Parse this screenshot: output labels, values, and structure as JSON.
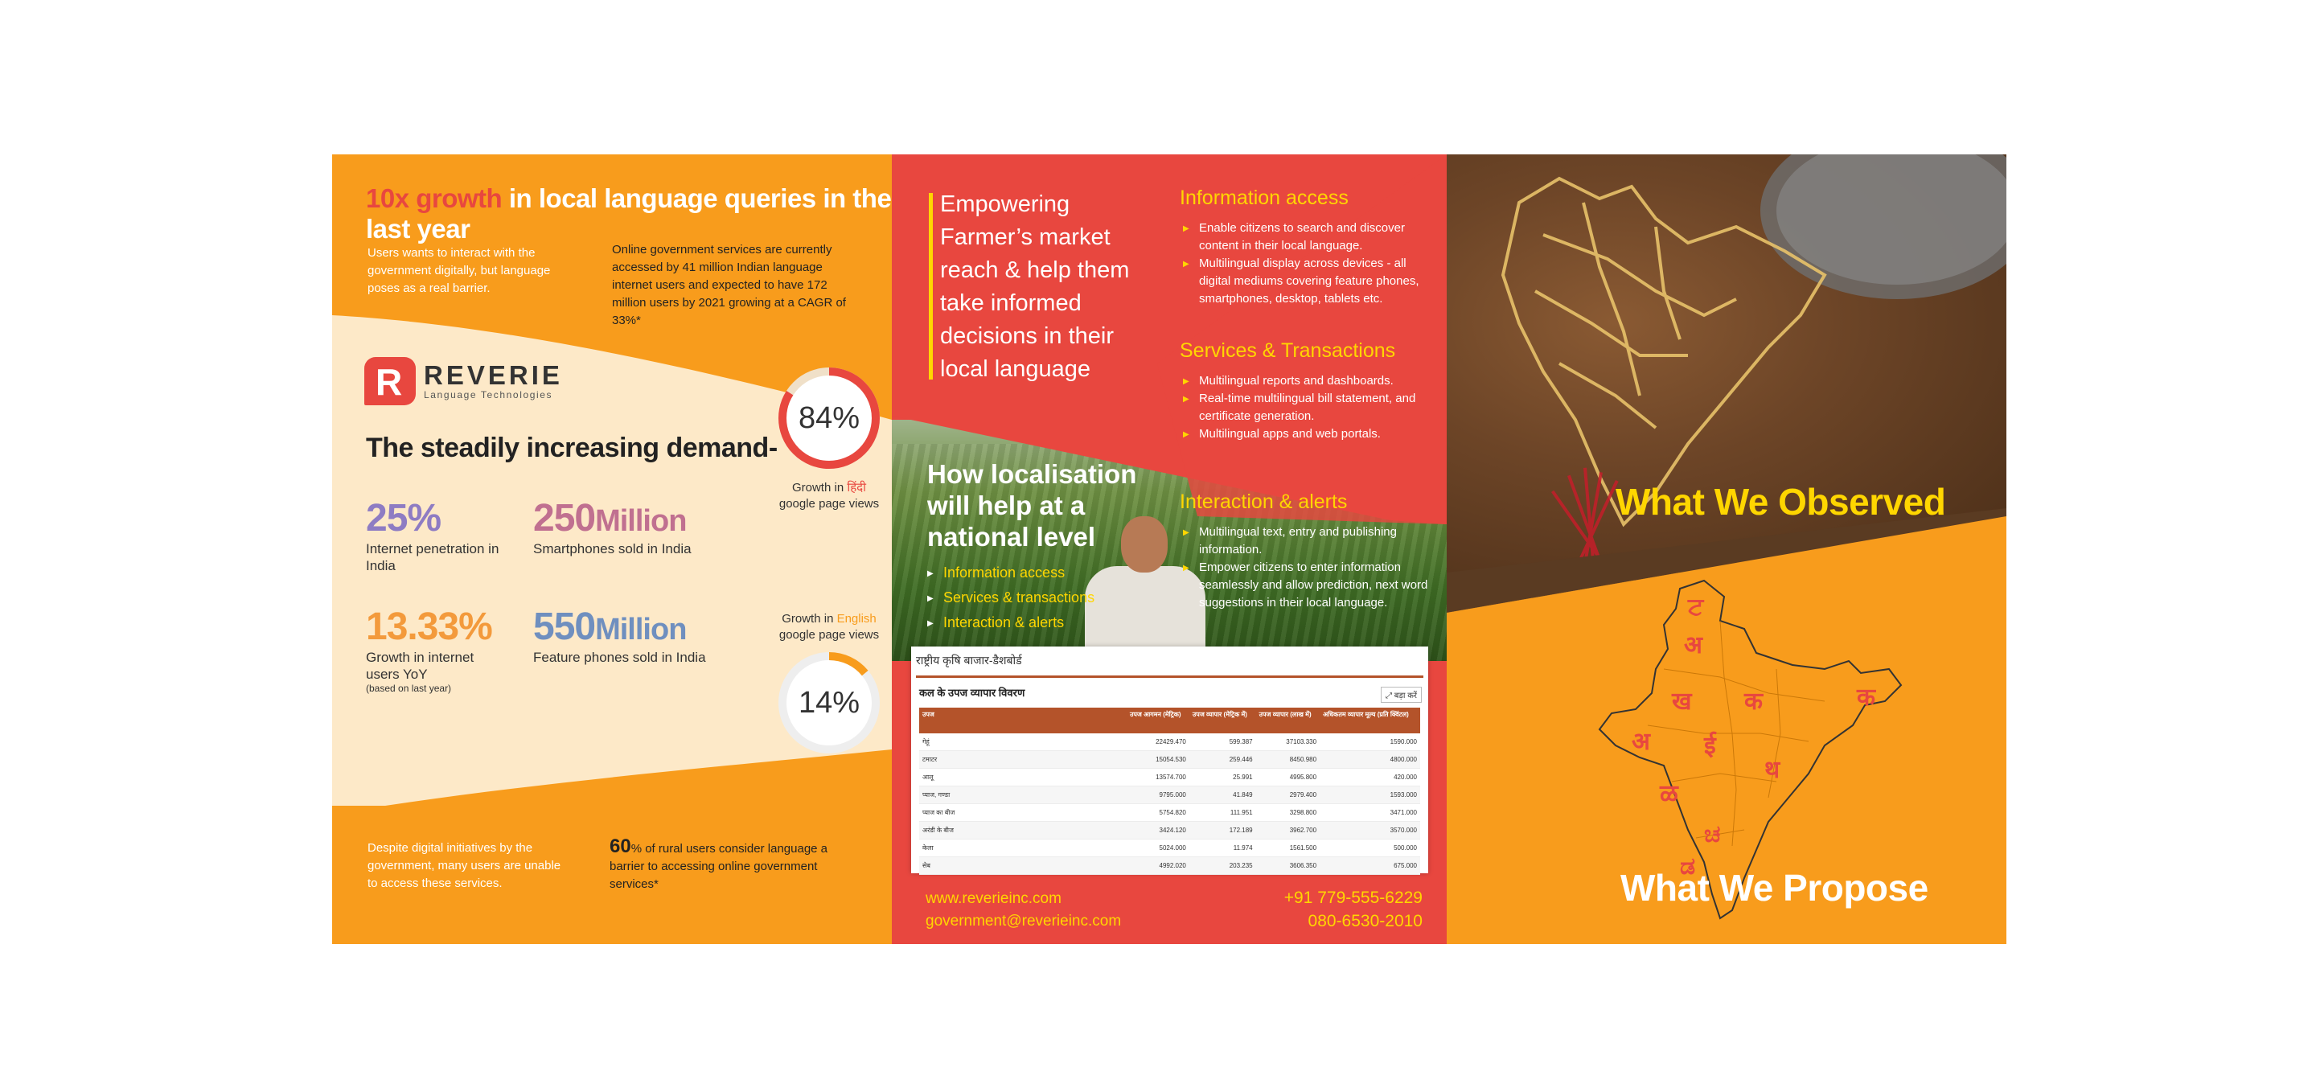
{
  "panel1": {
    "headline_highlight": "10x growth",
    "headline_rest": " in local language queries in the last year",
    "intro_left": "Users wants to interact with the government digitally, but language poses as a real barrier.",
    "intro_right": "Online government services are currently accessed by 41 million Indian language internet users and expected to have 172 million users by 2021 growing at a CAGR of 33%*",
    "logo_mark": "R",
    "logo_name": "REVERIE",
    "logo_sub": "Language Technologies",
    "demand_title": "The steadily increasing demand-",
    "stats": [
      {
        "value": "25%",
        "unit": "",
        "label": "Internet penetration in India",
        "note": "",
        "color": "#8e7cc3"
      },
      {
        "value": "250",
        "unit": "Million",
        "label": "Smartphones sold in India",
        "note": "",
        "color": "#c07090"
      },
      {
        "value": "13.33%",
        "unit": "",
        "label": "Growth in internet users YoY",
        "note": "(based on last year)",
        "color": "#f39a3c"
      },
      {
        "value": "550",
        "unit": "Million",
        "label": "Feature phones sold in India",
        "note": "",
        "color": "#6f8fbf"
      }
    ],
    "ring_hindi": {
      "value_text": "84%",
      "fraction": 0.84,
      "label_pre": "Growth in ",
      "label_lang": "हिंदी",
      "label_post": "google page views",
      "color": "#e8473f"
    },
    "ring_english": {
      "value_text": "14%",
      "fraction": 0.14,
      "label_pre": "Growth in ",
      "label_lang": "English",
      "label_post": "google page views",
      "color": "#f89c1c"
    },
    "footer_left": "Despite digital initiatives by the government, many users are unable to access these services.",
    "footer_right_pct": "60",
    "footer_right_pct_suffix": "% of rural users consider language a barrier to accessing online government services*"
  },
  "panel2": {
    "empower_lines": [
      "Empowering",
      "Farmer’s market",
      "reach & help them",
      "take informed",
      "decisions in their",
      "local language"
    ],
    "sections": [
      {
        "title": "Information access",
        "items": [
          "Enable citizens to search and discover content in their local language.",
          "Multilingual display across devices - all digital mediums covering feature phones, smartphones, desktop, tablets etc."
        ]
      },
      {
        "title": "Services & Transactions",
        "items": [
          "Multilingual reports and dashboards.",
          "Real-time multilingual bill statement, and certificate generation.",
          "Multilingual apps and web portals."
        ]
      },
      {
        "title": "Interaction & alerts",
        "items": [
          "Multilingual text, entry and publishing information.",
          "Empower citizens to enter information seamlessly and allow prediction, next word suggestions in their local language."
        ]
      }
    ],
    "how_title_lines": [
      "How localisation",
      "will help at a",
      "national level"
    ],
    "how_items": [
      "Information access",
      "Services & transactions",
      "Interaction & alerts"
    ],
    "dashboard": {
      "title": "राष्ट्रीय कृषि बाजार-डैशबोर्ड",
      "subtitle": "कल के उपज व्यापार विवरण",
      "expand_label": "⤢ बड़ा करें",
      "columns": [
        "उपज",
        "उपज आगमन (मेट्रिक)",
        "उपज व्यापार (मेट्रिक में)",
        "उपज व्यापार (लाख में)",
        "अधिकतम व्यापार मूल्य (प्रति क्विंटल)"
      ],
      "rows": [
        [
          "गेहूं",
          "22429.470",
          "599.387",
          "37103.330",
          "1590.000"
        ],
        [
          "टमाटर",
          "15054.530",
          "259.446",
          "8450.980",
          "4800.000"
        ],
        [
          "आलू",
          "13574.700",
          "25.991",
          "4995.800",
          "420.000"
        ],
        [
          "प्याज, गण्डा",
          "9795.000",
          "41.849",
          "2979.400",
          "1593.000"
        ],
        [
          "प्याज का बीज",
          "5754.820",
          "111.951",
          "3298.800",
          "3471.000"
        ],
        [
          "अरंडी के बीज",
          "3424.120",
          "172.189",
          "3962.700",
          "3570.000"
        ],
        [
          "केला",
          "5024.000",
          "11.974",
          "1561.500",
          "500.000"
        ],
        [
          "सेब",
          "4992.020",
          "203.235",
          "3606.350",
          "675.000"
        ]
      ]
    },
    "contact": {
      "website": "www.reverieinc.com",
      "email": "government@reverieinc.com",
      "phone1": "+91 779-555-6229",
      "phone2": "080-6530-2010"
    }
  },
  "panel3": {
    "observed_title": "What We Observed",
    "propose_title": "What We Propose",
    "map_letters": [
      "ਟ",
      "अ",
      "ख",
      "क",
      "क",
      "अ",
      "ई",
      "थ",
      "ळ",
      "ಚ",
      "ಡ"
    ],
    "map_letter_color": "#e8473f"
  }
}
